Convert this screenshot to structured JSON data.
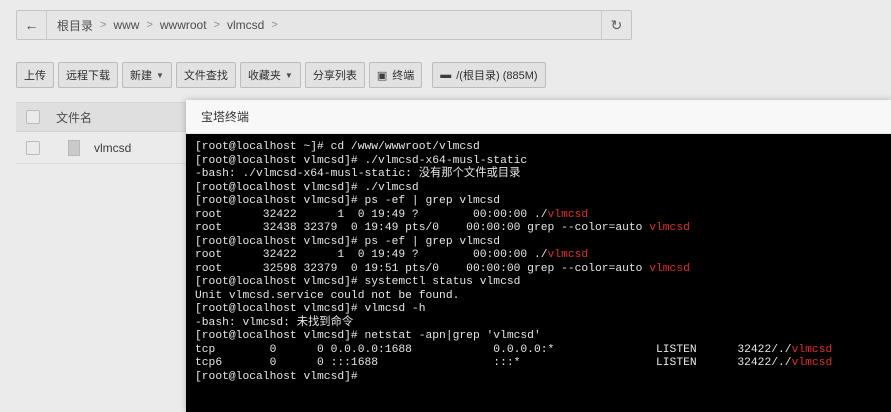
{
  "address_bar": {
    "back_icon": "arrow-left-icon",
    "crumbs": [
      "根目录",
      "www",
      "wwwroot",
      "vlmcsd"
    ],
    "separator": ">",
    "refresh_icon": "refresh-icon"
  },
  "toolbar": {
    "upload": "上传",
    "remote_download": "远程下载",
    "new": "新建",
    "file_search": "文件查找",
    "favorites": "收藏夹",
    "share_list": "分享列表",
    "terminal": "终端",
    "disk": "/(根目录) (885M)"
  },
  "table": {
    "header_filename": "文件名",
    "rows": [
      {
        "name": "vlmcsd"
      }
    ]
  },
  "terminal_modal": {
    "title": "宝塔终端",
    "lines": [
      [
        {
          "t": "[root@localhost ~]# cd /www/wwwroot/vlmcsd"
        }
      ],
      [
        {
          "t": "[root@localhost vlmcsd]# ./vlmcsd-x64-musl-static"
        }
      ],
      [
        {
          "t": "-bash: ./vlmcsd-x64-musl-static: 没有那个文件或目录"
        }
      ],
      [
        {
          "t": "[root@localhost vlmcsd]# ./vlmcsd"
        }
      ],
      [
        {
          "t": "[root@localhost vlmcsd]# ps -ef | grep vlmcsd"
        }
      ],
      [
        {
          "t": "root      32422      1  0 19:49 ?        00:00:00 ./"
        },
        {
          "t": "vlmcsd",
          "hl": true
        }
      ],
      [
        {
          "t": "root      32438 32379  0 19:49 pts/0    00:00:00 grep --color=auto "
        },
        {
          "t": "vlmcsd",
          "hl": true
        }
      ],
      [
        {
          "t": "[root@localhost vlmcsd]# ps -ef | grep vlmcsd"
        }
      ],
      [
        {
          "t": "root      32422      1  0 19:49 ?        00:00:00 ./"
        },
        {
          "t": "vlmcsd",
          "hl": true
        }
      ],
      [
        {
          "t": "root      32598 32379  0 19:51 pts/0    00:00:00 grep --color=auto "
        },
        {
          "t": "vlmcsd",
          "hl": true
        }
      ],
      [
        {
          "t": "[root@localhost vlmcsd]# systemctl status vlmcsd"
        }
      ],
      [
        {
          "t": "Unit vlmcsd.service could not be found."
        }
      ],
      [
        {
          "t": "[root@localhost vlmcsd]# vlmcsd -h"
        }
      ],
      [
        {
          "t": "-bash: vlmcsd: 未找到命令"
        }
      ],
      [
        {
          "t": "[root@localhost vlmcsd]# netstat -apn|grep 'vlmcsd'"
        }
      ],
      [
        {
          "t": "tcp        0      0 0.0.0.0:1688            0.0.0.0:*               LISTEN      32422/./"
        },
        {
          "t": "vlmcsd",
          "hl": true
        }
      ],
      [
        {
          "t": "tcp6       0      0 :::1688                 :::*                    LISTEN      32422/./"
        },
        {
          "t": "vlmcsd",
          "hl": true
        }
      ],
      [
        {
          "t": "[root@localhost vlmcsd]# "
        }
      ]
    ],
    "highlight_color": "#e62a2a"
  }
}
